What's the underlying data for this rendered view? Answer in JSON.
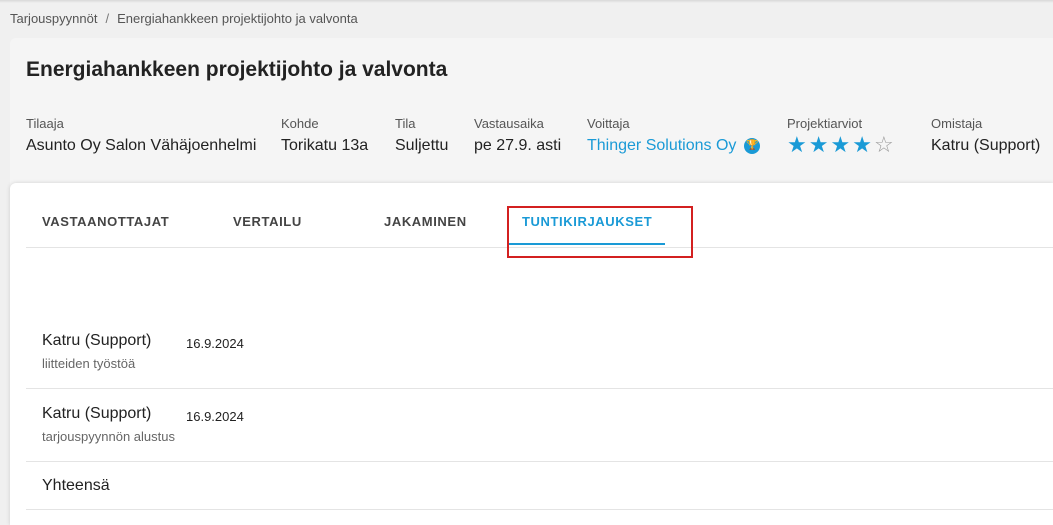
{
  "breadcrumb": {
    "root": "Tarjouspyynnöt",
    "separator": "/",
    "current": "Energiahankkeen projektijohto ja valvonta"
  },
  "header": {
    "title": "Energiahankkeen projektijohto ja valvonta",
    "fields": {
      "tilaaja": {
        "label": "Tilaaja",
        "value": "Asunto Oy Salon Vähäjoenhelmi"
      },
      "kohde": {
        "label": "Kohde",
        "value": "Torikatu 13a"
      },
      "tila": {
        "label": "Tila",
        "value": "Suljettu"
      },
      "vastausaika": {
        "label": "Vastausaika",
        "value": "pe 27.9. asti"
      },
      "voittaja": {
        "label": "Voittaja",
        "value": "Thinger Solutions Oy",
        "icon": "trophy-icon"
      },
      "projektiarviot": {
        "label": "Projektiarviot",
        "rating": 4,
        "max": 5
      },
      "omistaja": {
        "label": "Omistaja",
        "value": "Katru (Support)"
      }
    }
  },
  "tabs": [
    {
      "label": "VASTAANOTTAJAT",
      "active": false
    },
    {
      "label": "VERTAILU",
      "active": false
    },
    {
      "label": "JAKAMINEN",
      "active": false
    },
    {
      "label": "TUNTIKIRJAUKSET",
      "active": true
    }
  ],
  "entries": [
    {
      "name": "Katru (Support)",
      "date": "16.9.2024",
      "description": "liitteiden työstöä"
    },
    {
      "name": "Katru (Support)",
      "date": "16.9.2024",
      "description": "tarjouspyynnön alustus"
    }
  ],
  "total_label": "Yhteensä",
  "colors": {
    "accent": "#1a9ad6",
    "highlight": "#d32020"
  }
}
